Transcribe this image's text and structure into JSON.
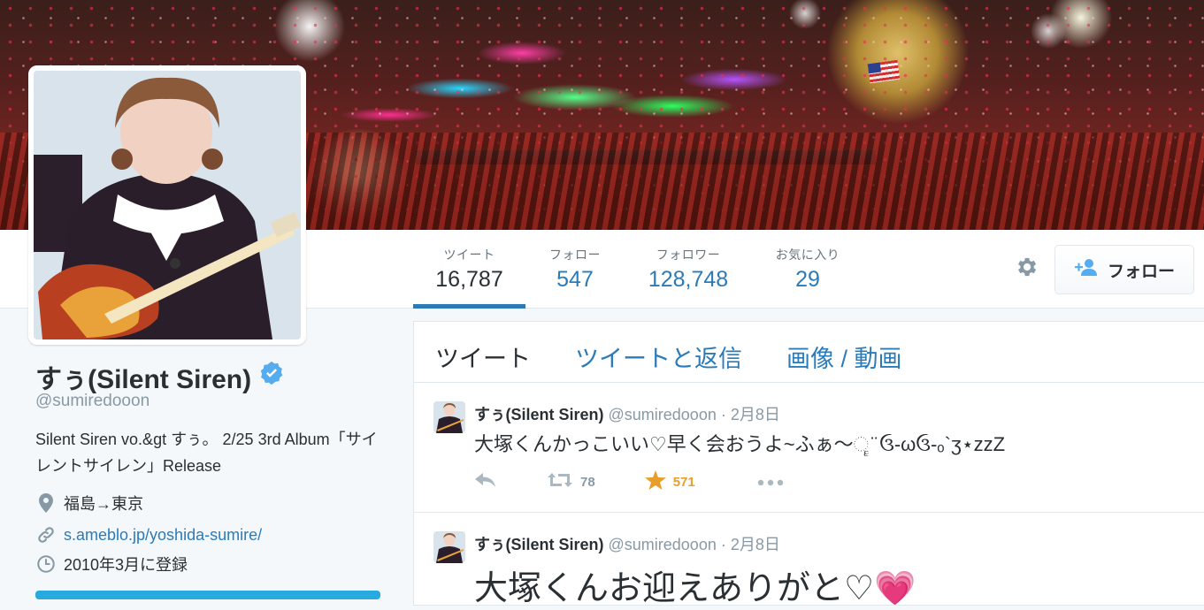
{
  "profile": {
    "name": "すぅ(Silent Siren)",
    "handle": "@sumiredooon",
    "bio": "Silent Siren vo.&gt すぅ。 2/25 3rd Album「サイレントサイレン」Release",
    "location": "福島→東京",
    "website": "s.ameblo.jp/yoshida-sumire/",
    "joined": "2010年3月に登録",
    "verified_icon": "verified-badge-icon"
  },
  "stats": [
    {
      "label": "ツイート",
      "value": "16,787"
    },
    {
      "label": "フォロー",
      "value": "547"
    },
    {
      "label": "フォロワー",
      "value": "128,748"
    },
    {
      "label": "お気に入り",
      "value": "29"
    }
  ],
  "actions": {
    "follow_label": "フォロー",
    "gear_icon": "gear-icon",
    "follow_icon": "add-user-icon"
  },
  "timeline": {
    "tabs": [
      "ツイート",
      "ツイートと返信",
      "画像 / 動画"
    ],
    "tweets": [
      {
        "name": "すぅ(Silent Siren)",
        "handle": "@sumiredooon",
        "date": "· 2月8日",
        "text": "大塚くんかっこいい♡早く会おうよ~ふぁ〜ૄ ̈ ઉ-ωઉ-ₒ`ʒ⋆zzZ",
        "retweets": "78",
        "favorites": "571"
      },
      {
        "name": "すぅ(Silent Siren)",
        "handle": "@sumiredooon",
        "date": "· 2月8日",
        "text": "大塚くんお迎えありがと♡💗"
      }
    ]
  },
  "colors": {
    "link": "#2b7bb9",
    "favorite": "#e89e2a",
    "muted": "#8899a6",
    "verified": "#55acee"
  }
}
